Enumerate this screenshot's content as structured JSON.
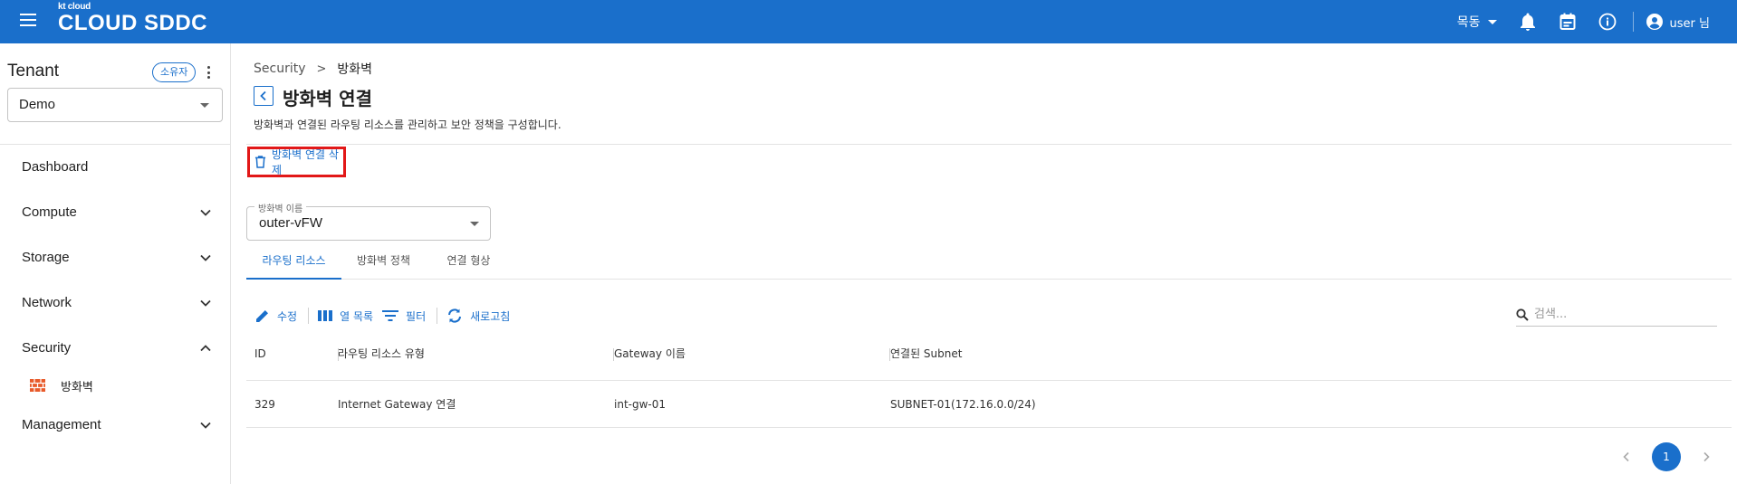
{
  "topbar": {
    "logo_small": "kt cloud",
    "logo_big": "CLOUD SDDC",
    "region": "목동",
    "user": "user 님"
  },
  "sidebar": {
    "tenant_title": "Tenant",
    "owner_badge": "소유자",
    "tenant_value": "Demo",
    "nav": {
      "dashboard": "Dashboard",
      "compute": "Compute",
      "storage": "Storage",
      "network": "Network",
      "security": "Security",
      "firewall": "방화벽",
      "management": "Management"
    }
  },
  "main": {
    "breadcrumb": [
      "Security",
      "방화벽"
    ],
    "title": "방화벽 연결",
    "description": "방화벽과 연결된 라우팅 리소스를 관리하고 보안 정책을 구성합니다.",
    "delete_label": "방화벽 연결 삭제",
    "fw_select_label": "방화벽 이름",
    "fw_select_value": "outer-vFW",
    "tabs": [
      "라우팅 리소스",
      "방화벽 정책",
      "연결 형상"
    ],
    "toolbar": {
      "edit": "수정",
      "columns": "열 목록",
      "filter": "필터",
      "refresh": "새로고침"
    },
    "search_placeholder": "검색...",
    "table": {
      "headers": [
        "ID",
        "라우팅 리소스 유형",
        "Gateway 이름",
        "연결된 Subnet"
      ],
      "rows": [
        [
          "329",
          "Internet Gateway 연결",
          "int-gw-01",
          "SUBNET-01(172.16.0.0/24)"
        ]
      ]
    },
    "pagination": {
      "current": "1"
    }
  },
  "colors": {
    "brand": "#1a6fcb",
    "highlight": "#e21818",
    "firewall_icon": "#e85a2a"
  }
}
